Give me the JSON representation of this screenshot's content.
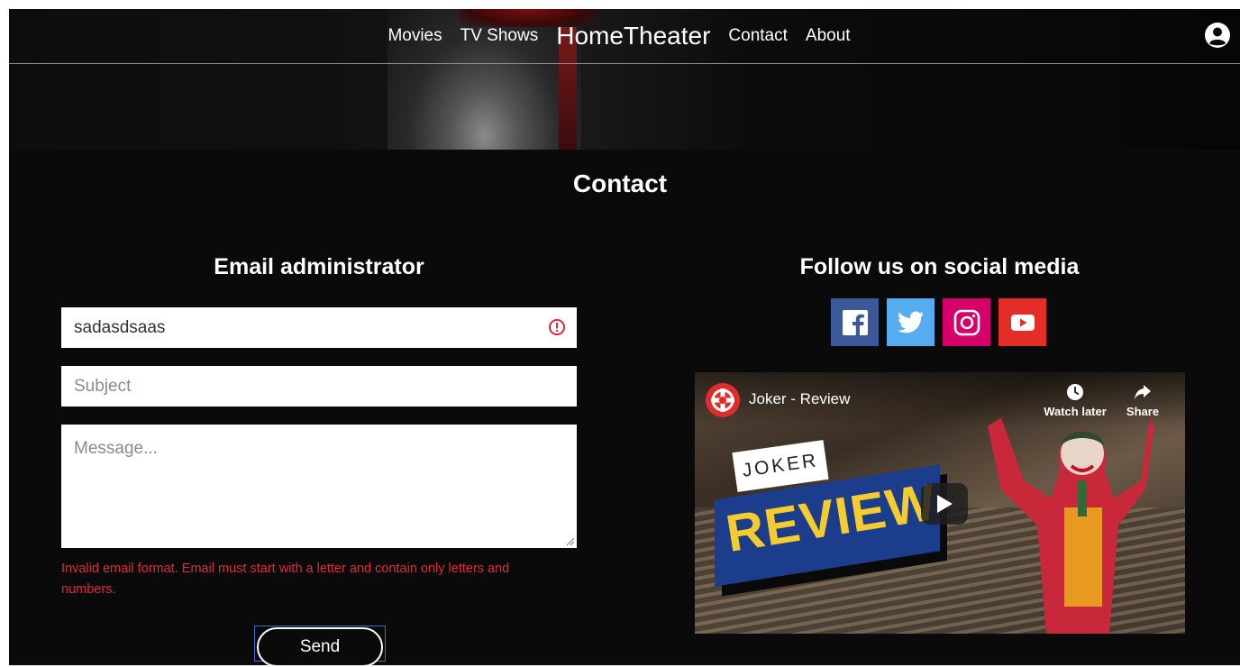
{
  "nav": {
    "links_left": [
      "Movies",
      "TV Shows"
    ],
    "brand": "HomeTheater",
    "links_right": [
      "Contact",
      "About"
    ]
  },
  "page": {
    "title": "Contact"
  },
  "form": {
    "heading": "Email administrator",
    "email_value": "sadasdsaas",
    "subject_placeholder": "Subject",
    "message_placeholder": "Message...",
    "error_message": "Invalid email format. Email must start with a letter and contain only letters and numbers.",
    "send_label": "Send"
  },
  "social": {
    "heading": "Follow us on social media",
    "icons": [
      "facebook-icon",
      "twitter-icon",
      "instagram-icon",
      "youtube-icon"
    ]
  },
  "video": {
    "title": "Joker - Review",
    "watch_later_label": "Watch later",
    "share_label": "Share",
    "thumb_label_top": "JOKER",
    "thumb_label_main": "REVIEW"
  },
  "colors": {
    "background": "#0a0a0b",
    "error": "#e0293a",
    "facebook": "#3b5998",
    "twitter": "#55acee",
    "instagram": "#d6006b",
    "youtube": "#e52d27"
  }
}
